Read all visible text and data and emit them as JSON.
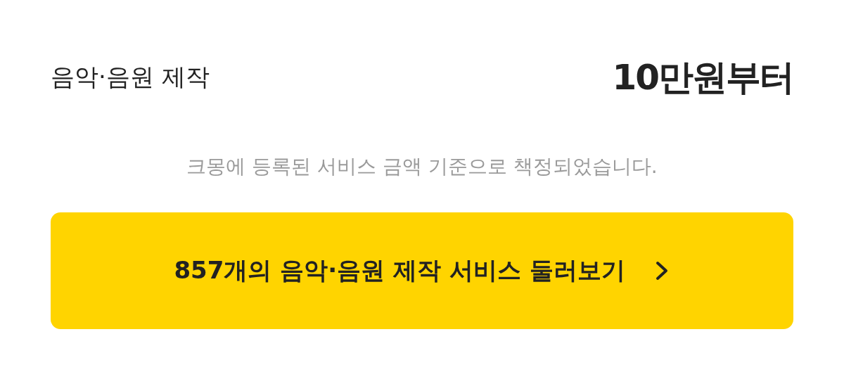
{
  "category": "음악·음원 제작",
  "price": "10만원부터",
  "note": "크몽에 등록된 서비스 금액 기준으로 책정되었습니다.",
  "button": {
    "label": "857개의 음악·음원 제작 서비스 둘러보기"
  }
}
